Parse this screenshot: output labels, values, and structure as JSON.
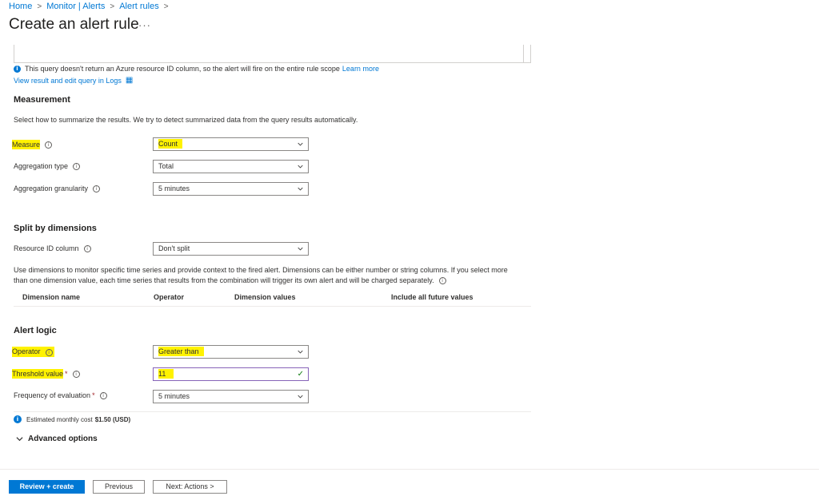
{
  "breadcrumb": {
    "items": [
      "Home",
      "Monitor | Alerts",
      "Alert rules"
    ]
  },
  "page": {
    "title": "Create an alert rule",
    "more": "···"
  },
  "query_info": {
    "message": "This query doesn't return an Azure resource ID column, so the alert will fire on the entire rule scope",
    "learn_more": "Learn more",
    "view_link": "View result and edit query in Logs"
  },
  "measurement": {
    "title": "Measurement",
    "description": "Select how to summarize the results. We try to detect summarized data from the query results automatically.",
    "measure": {
      "label": "Measure",
      "value": "Count"
    },
    "aggregation_type": {
      "label": "Aggregation type",
      "value": "Total"
    },
    "aggregation_granularity": {
      "label": "Aggregation granularity",
      "value": "5 minutes"
    }
  },
  "split": {
    "title": "Split by dimensions",
    "resource_id": {
      "label": "Resource ID column",
      "value": "Don't split"
    },
    "description_line1": "Use dimensions to monitor specific time series and provide context to the fired alert. Dimensions can be either number or string columns. If you select more",
    "description_line2": "than one dimension value, each time series that results from the combination will trigger its own alert and will be charged separately.",
    "columns": [
      "Dimension name",
      "Operator",
      "Dimension values",
      "Include all future values"
    ]
  },
  "alert_logic": {
    "title": "Alert logic",
    "operator": {
      "label": "Operator",
      "value": "Greater than"
    },
    "threshold": {
      "label": "Threshold value",
      "required": "*",
      "value": "11"
    },
    "frequency": {
      "label": "Frequency of evaluation",
      "required": "*",
      "value": "5 minutes"
    }
  },
  "cost": {
    "text": "Estimated monthly cost",
    "value": "$1.50 (USD)"
  },
  "advanced": {
    "label": "Advanced options"
  },
  "footer": {
    "review": "Review + create",
    "previous": "Previous",
    "next": "Next: Actions >"
  },
  "colors": {
    "accent": "#0078d4",
    "highlight": "#fff200",
    "required": "#a4262c"
  }
}
